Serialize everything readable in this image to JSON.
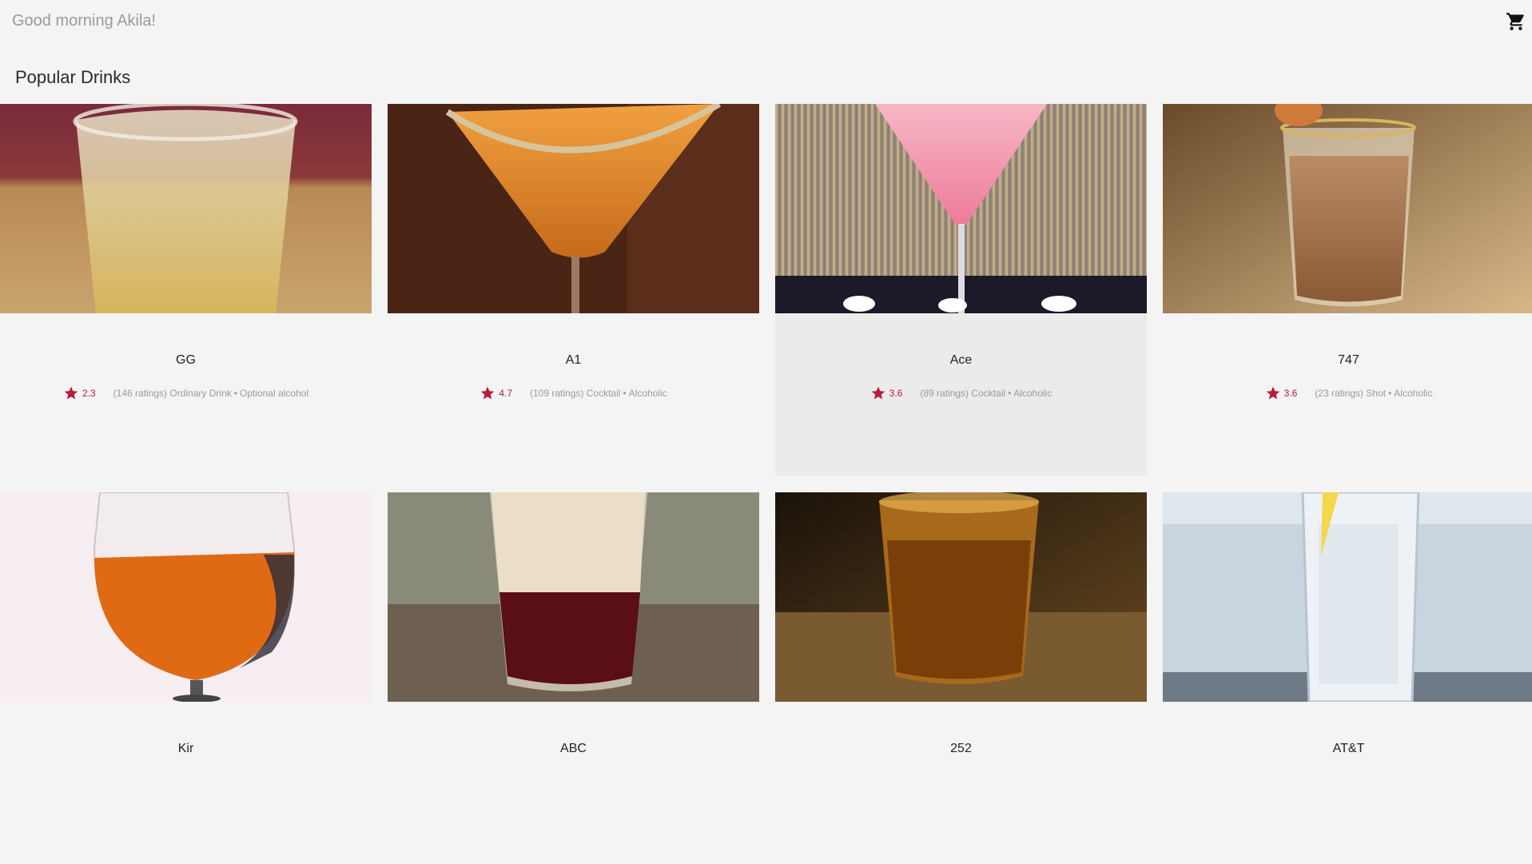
{
  "header": {
    "greeting": "Good morning Akila!",
    "cart_icon": "shopping-cart-icon"
  },
  "section": {
    "title": "Popular Drinks"
  },
  "colors": {
    "rating_star": "#b71c3a",
    "background": "#f4f4f4",
    "hover_card": "#ebebeb"
  },
  "drinks": [
    {
      "name": "GG",
      "rating": "2.3",
      "ratings_count": "(146 ratings)",
      "category": "Ordinary Drink",
      "alcohol": "Optional alcohol"
    },
    {
      "name": "A1",
      "rating": "4.7",
      "ratings_count": "(109 ratings)",
      "category": "Cocktail",
      "alcohol": "Alcoholic"
    },
    {
      "name": "Ace",
      "rating": "3.6",
      "ratings_count": "(89 ratings)",
      "category": "Cocktail",
      "alcohol": "Alcoholic"
    },
    {
      "name": "747",
      "rating": "3.6",
      "ratings_count": "(23 ratings)",
      "category": "Shot",
      "alcohol": "Alcoholic"
    },
    {
      "name": "Kir"
    },
    {
      "name": "ABC"
    },
    {
      "name": "252"
    },
    {
      "name": "AT&T"
    }
  ]
}
